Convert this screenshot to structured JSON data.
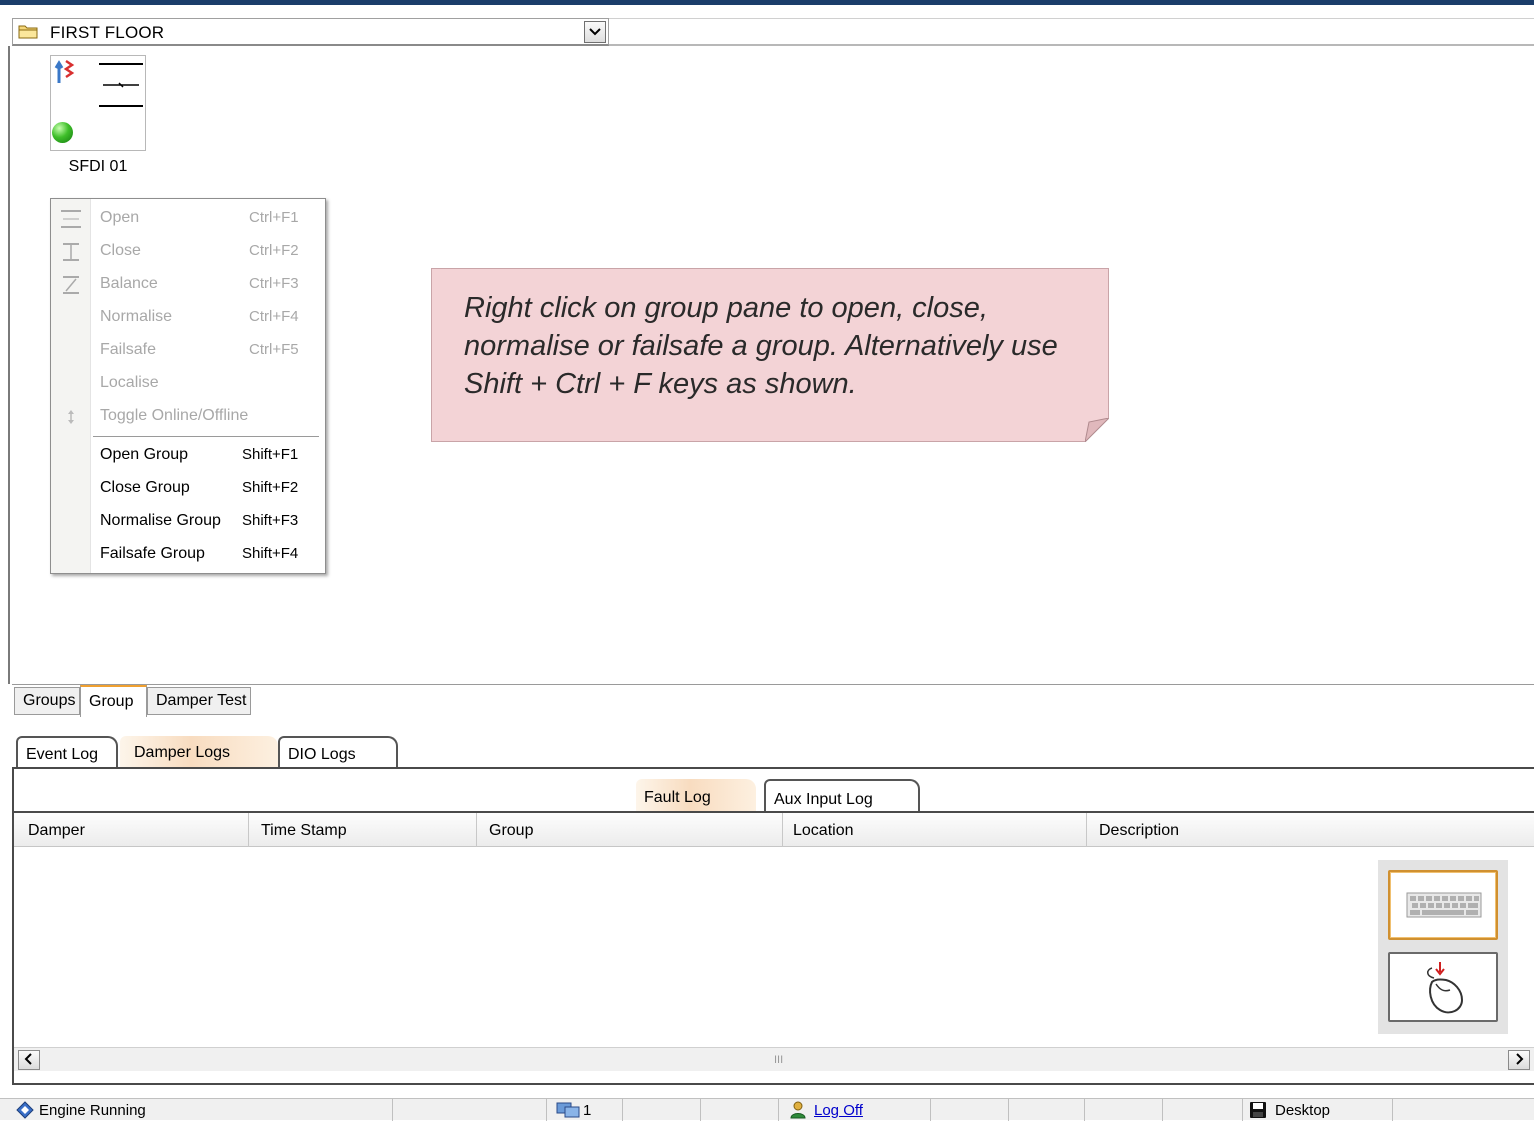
{
  "floor_selector": {
    "value": "FIRST FLOOR"
  },
  "damper": {
    "name": "SFDI 01"
  },
  "context_menu": {
    "items": [
      {
        "label": "Open",
        "shortcut": "Ctrl+F1",
        "enabled": false
      },
      {
        "label": "Close",
        "shortcut": "Ctrl+F2",
        "enabled": false
      },
      {
        "label": "Balance",
        "shortcut": "Ctrl+F3",
        "enabled": false
      },
      {
        "label": "Normalise",
        "shortcut": "Ctrl+F4",
        "enabled": false
      },
      {
        "label": "Failsafe",
        "shortcut": "Ctrl+F5",
        "enabled": false
      },
      {
        "label": "Localise",
        "shortcut": "",
        "enabled": false
      },
      {
        "label": "Toggle Online/Offline",
        "shortcut": "",
        "enabled": false
      },
      {
        "label": "Open Group",
        "shortcut": "Shift+F1",
        "enabled": true
      },
      {
        "label": "Close Group",
        "shortcut": "Shift+F2",
        "enabled": true
      },
      {
        "label": "Normalise Group",
        "shortcut": "Shift+F3",
        "enabled": true
      },
      {
        "label": "Failsafe Group",
        "shortcut": "Shift+F4",
        "enabled": true
      }
    ]
  },
  "note": {
    "text": "Right click on group pane to open, close, normalise or failsafe a group. Alternatively use Shift + Ctrl + F keys as shown."
  },
  "view_tabs": [
    {
      "label": "Groups"
    },
    {
      "label": "Group",
      "active": true
    },
    {
      "label": "Damper Test"
    }
  ],
  "log_tabs": [
    {
      "label": "Event Log"
    },
    {
      "label": "Damper Logs",
      "active": true
    },
    {
      "label": "DIO Logs"
    }
  ],
  "sub_tabs": [
    {
      "label": "Fault Log",
      "active": true
    },
    {
      "label": "Aux Input Log"
    }
  ],
  "grid": {
    "columns": [
      "Damper",
      "Time Stamp",
      "Group",
      "Location",
      "Description"
    ]
  },
  "scrollbar": {
    "grip": "III"
  },
  "status_bar": {
    "engine": "Engine Running",
    "count": "1",
    "logoff": "Log Off",
    "desktop": "Desktop"
  },
  "colors": {
    "accent": "#f0a030",
    "note_bg": "#f3d3d6",
    "title_bar": "#1b3d6a"
  }
}
